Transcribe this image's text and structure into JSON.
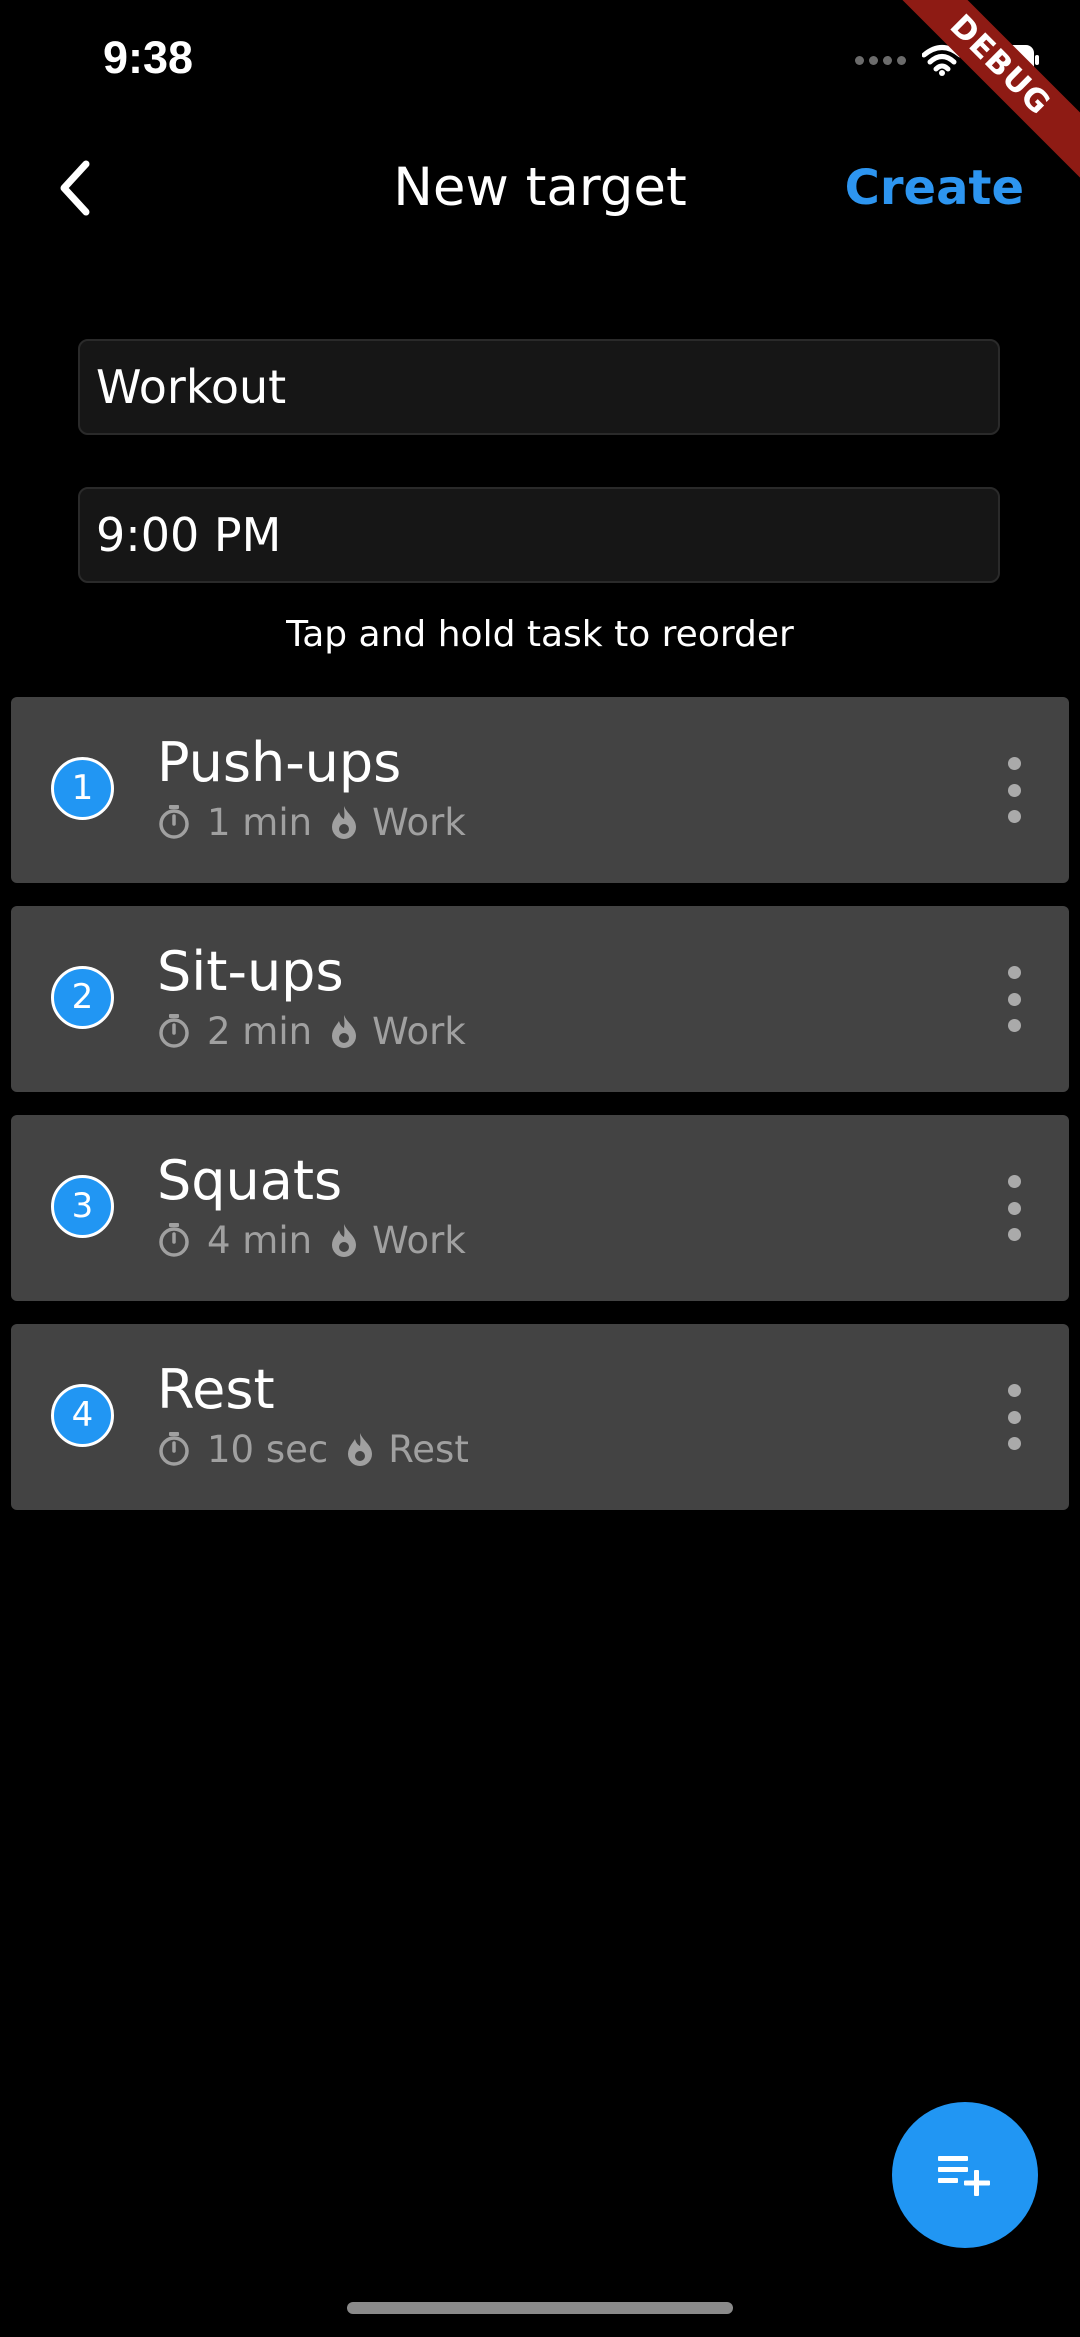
{
  "status_bar": {
    "time": "9:38",
    "debug_label": "DEBUG"
  },
  "header": {
    "title": "New target",
    "create_label": "Create"
  },
  "form": {
    "name_value": "Workout",
    "time_value": "9:00 PM"
  },
  "hint": "Tap and hold task to reorder",
  "tasks": [
    {
      "number": "1",
      "name": "Push-ups",
      "duration": "1 min",
      "type": "Work"
    },
    {
      "number": "2",
      "name": "Sit-ups",
      "duration": "2 min",
      "type": "Work"
    },
    {
      "number": "3",
      "name": "Squats",
      "duration": "4 min",
      "type": "Work"
    },
    {
      "number": "4",
      "name": "Rest",
      "duration": "10 sec",
      "type": "Rest"
    }
  ],
  "icons": {
    "back": "chevron-left-icon",
    "timer": "timer-icon",
    "category": "fire-icon",
    "menu": "more-vertical-icon",
    "add": "playlist-add-icon"
  },
  "colors": {
    "accent": "#2196f3",
    "create": "#2d95f0",
    "card": "#434343",
    "background": "#000000"
  }
}
